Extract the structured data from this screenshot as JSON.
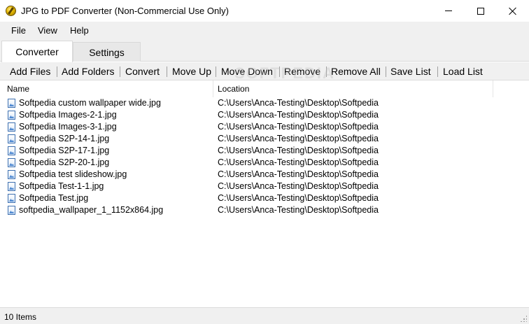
{
  "window": {
    "title": "JPG to PDF Converter (Non-Commercial Use Only)"
  },
  "menu": {
    "items": [
      "File",
      "View",
      "Help"
    ]
  },
  "tabs": [
    {
      "label": "Converter",
      "active": true
    },
    {
      "label": "Settings",
      "active": false
    }
  ],
  "toolbar": {
    "buttons": [
      "Add Files",
      "Add Folders",
      "Convert",
      "Move Up",
      "Move Down",
      "Remove",
      "Remove All",
      "Save List",
      "Load List"
    ]
  },
  "list": {
    "columns": [
      "Name",
      "Location"
    ],
    "rows": [
      {
        "name": "Softpedia custom wallpaper wide.jpg",
        "location": "C:\\Users\\Anca-Testing\\Desktop\\Softpedia"
      },
      {
        "name": "Softpedia Images-2-1.jpg",
        "location": "C:\\Users\\Anca-Testing\\Desktop\\Softpedia"
      },
      {
        "name": "Softpedia Images-3-1.jpg",
        "location": "C:\\Users\\Anca-Testing\\Desktop\\Softpedia"
      },
      {
        "name": "Softpedia S2P-14-1.jpg",
        "location": "C:\\Users\\Anca-Testing\\Desktop\\Softpedia"
      },
      {
        "name": "Softpedia S2P-17-1.jpg",
        "location": "C:\\Users\\Anca-Testing\\Desktop\\Softpedia"
      },
      {
        "name": "Softpedia S2P-20-1.jpg",
        "location": "C:\\Users\\Anca-Testing\\Desktop\\Softpedia"
      },
      {
        "name": "Softpedia test slideshow.jpg",
        "location": "C:\\Users\\Anca-Testing\\Desktop\\Softpedia"
      },
      {
        "name": "Softpedia Test-1-1.jpg",
        "location": "C:\\Users\\Anca-Testing\\Desktop\\Softpedia"
      },
      {
        "name": "Softpedia Test.jpg",
        "location": "C:\\Users\\Anca-Testing\\Desktop\\Softpedia"
      },
      {
        "name": "softpedia_wallpaper_1_1152x864.jpg",
        "location": "C:\\Users\\Anca-Testing\\Desktop\\Softpedia"
      }
    ]
  },
  "status": {
    "text": "10 Items"
  },
  "watermark": "SOFTPEDIA",
  "icons": {
    "app": "coin-icon",
    "file": "image-file-icon"
  }
}
